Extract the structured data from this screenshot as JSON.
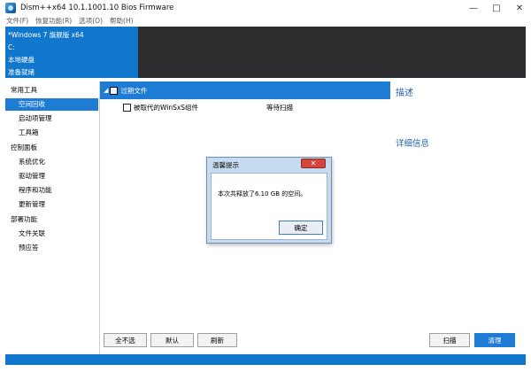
{
  "window": {
    "title": "Dism++x64 10.1.1001.10 Bios Firmware",
    "controls": {
      "minimize": "—",
      "maximize": "□",
      "close": "✕"
    }
  },
  "menubar": {
    "items": [
      "文件(F)",
      "恢复功能(R)",
      "选项(O)",
      "帮助(H)"
    ]
  },
  "system": {
    "lines": [
      "*Windows 7 旗舰版 x64",
      "C:",
      "本地硬盘",
      "准备就绪"
    ]
  },
  "sidebar": {
    "groups": [
      {
        "label": "常用工具",
        "items": [
          "空间回收",
          "启动项管理",
          "工具箱"
        ]
      },
      {
        "label": "控制面板",
        "items": [
          "系统优化",
          "驱动管理",
          "程序和功能",
          "更新管理"
        ]
      },
      {
        "label": "部署功能",
        "items": [
          "文件关联",
          "预应答"
        ]
      }
    ],
    "active": "空间回收"
  },
  "list": {
    "header_label": "过期文件",
    "rows": [
      {
        "label": "被取代的WinSxS组件",
        "status": "等待扫描"
      }
    ]
  },
  "panel": {
    "description_title": "描述",
    "detail_title": "详细信息"
  },
  "buttons": {
    "deselect_all": "全不选",
    "default": "默认",
    "refresh": "刷新",
    "scan": "扫描",
    "clean": "清理"
  },
  "dialog": {
    "title": "温馨提示",
    "message": "本次共释放了6.10 GB 的空间。",
    "ok": "确定",
    "close": "✕"
  },
  "colors": {
    "accent": "#1f7cd5",
    "system_panel": "#1177cc",
    "dark_panel": "#2d2d30",
    "dialog_frame": "#c5dbf0",
    "close_red": "#d6453d"
  }
}
